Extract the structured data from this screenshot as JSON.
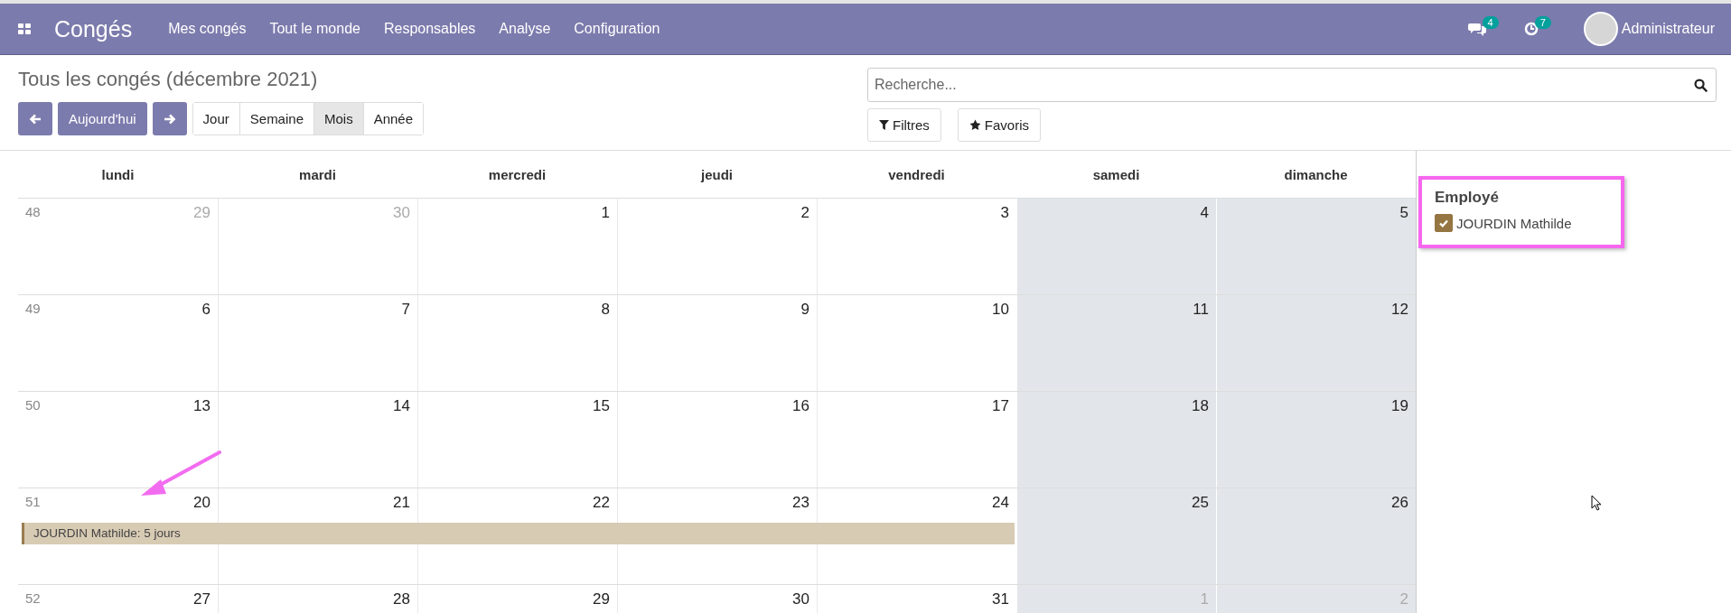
{
  "navbar": {
    "app_title": "Congés",
    "menu": [
      "Mes congés",
      "Tout le monde",
      "Responsables",
      "Analyse",
      "Configuration"
    ],
    "messages_count": "4",
    "activities_count": "7",
    "user": "Administrateur"
  },
  "control_panel": {
    "title": "Tous les congés (décembre 2021)",
    "today_button": "Aujourd'hui",
    "views": [
      {
        "label": "Jour",
        "selected": false
      },
      {
        "label": "Semaine",
        "selected": false
      },
      {
        "label": "Mois",
        "selected": true
      },
      {
        "label": "Année",
        "selected": false
      }
    ],
    "search": {
      "placeholder": "Recherche..."
    },
    "filters_button": "Filtres",
    "favorites_button": "Favoris"
  },
  "calendar": {
    "weekdays": [
      {
        "label": "lundi",
        "weekend": false
      },
      {
        "label": "mardi",
        "weekend": false
      },
      {
        "label": "mercredi",
        "weekend": false
      },
      {
        "label": "jeudi",
        "weekend": false
      },
      {
        "label": "vendredi",
        "weekend": false
      },
      {
        "label": "samedi",
        "weekend": true
      },
      {
        "label": "dimanche",
        "weekend": true
      }
    ],
    "weeks": [
      {
        "number": "48",
        "days": [
          {
            "label": "29",
            "other_month": true
          },
          {
            "label": "30",
            "other_month": true
          },
          {
            "label": "1",
            "other_month": false
          },
          {
            "label": "2",
            "other_month": false
          },
          {
            "label": "3",
            "other_month": false
          },
          {
            "label": "4",
            "other_month": false
          },
          {
            "label": "5",
            "other_month": false
          }
        ]
      },
      {
        "number": "49",
        "days": [
          {
            "label": "6",
            "other_month": false
          },
          {
            "label": "7",
            "other_month": false
          },
          {
            "label": "8",
            "other_month": false
          },
          {
            "label": "9",
            "other_month": false
          },
          {
            "label": "10",
            "other_month": false
          },
          {
            "label": "11",
            "other_month": false
          },
          {
            "label": "12",
            "other_month": false
          }
        ]
      },
      {
        "number": "50",
        "days": [
          {
            "label": "13",
            "other_month": false
          },
          {
            "label": "14",
            "other_month": false
          },
          {
            "label": "15",
            "other_month": false
          },
          {
            "label": "16",
            "other_month": false
          },
          {
            "label": "17",
            "other_month": false
          },
          {
            "label": "18",
            "other_month": false
          },
          {
            "label": "19",
            "other_month": false
          }
        ]
      },
      {
        "number": "51",
        "days": [
          {
            "label": "20",
            "other_month": false,
            "event": {
              "text": "JOURDIN Mathilde: 5 jours",
              "color": "#d8cbb4"
            }
          },
          {
            "label": "21",
            "other_month": false
          },
          {
            "label": "22",
            "other_month": false
          },
          {
            "label": "23",
            "other_month": false
          },
          {
            "label": "24",
            "other_month": false
          },
          {
            "label": "25",
            "other_month": false
          },
          {
            "label": "26",
            "other_month": false
          }
        ]
      },
      {
        "number": "52",
        "days": [
          {
            "label": "27",
            "other_month": false
          },
          {
            "label": "28",
            "other_month": false
          },
          {
            "label": "29",
            "other_month": false
          },
          {
            "label": "30",
            "other_month": false
          },
          {
            "label": "31",
            "other_month": false
          },
          {
            "label": "1",
            "other_month": true
          },
          {
            "label": "2",
            "other_month": true
          }
        ]
      }
    ]
  },
  "sidebar": {
    "filter_title": "Employé",
    "filters": [
      {
        "label": "JOURDIN Mathilde",
        "checked": true,
        "color": "#957541"
      }
    ]
  }
}
